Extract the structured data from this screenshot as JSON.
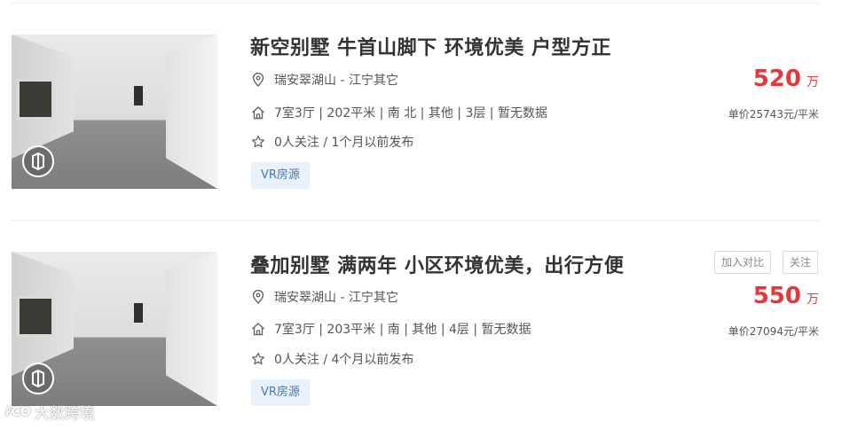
{
  "listings": [
    {
      "title": "新空别墅 牛首山脚下 环境优美 户型方正",
      "location": "瑞安翠湖山 - 江宁其它",
      "details": "7室3厅 | 202平米 | 南 北 | 其他 | 3层 | 暂无数据",
      "followers": "0人关注 / 1个月以前发布",
      "tag": "VR房源",
      "price": "520",
      "price_unit": "万",
      "unit_price": "单价25743元/平米"
    },
    {
      "title": "叠加别墅 满两年 小区环境优美，出行方便",
      "location": "瑞安翠湖山 - 江宁其它",
      "details": "7室3厅 | 203平米 | 南 | 其他 | 4层 | 暂无数据",
      "followers": "0人关注 / 4个月以前发布",
      "tag": "VR房源",
      "price": "550",
      "price_unit": "万",
      "unit_price": "单价27094元/平米",
      "compare_label": "加入对比",
      "follow_label": "关注"
    }
  ],
  "watermark": {
    "logo": "ℓCO",
    "text": "大数跨境"
  },
  "icons": {
    "location": "location-pin-icon",
    "house": "house-icon",
    "star": "star-icon",
    "vr": "vr-badge-icon"
  },
  "colors": {
    "price": "#e4393c",
    "tag_bg": "#e8f1fc",
    "tag_text": "#4a77b4"
  }
}
